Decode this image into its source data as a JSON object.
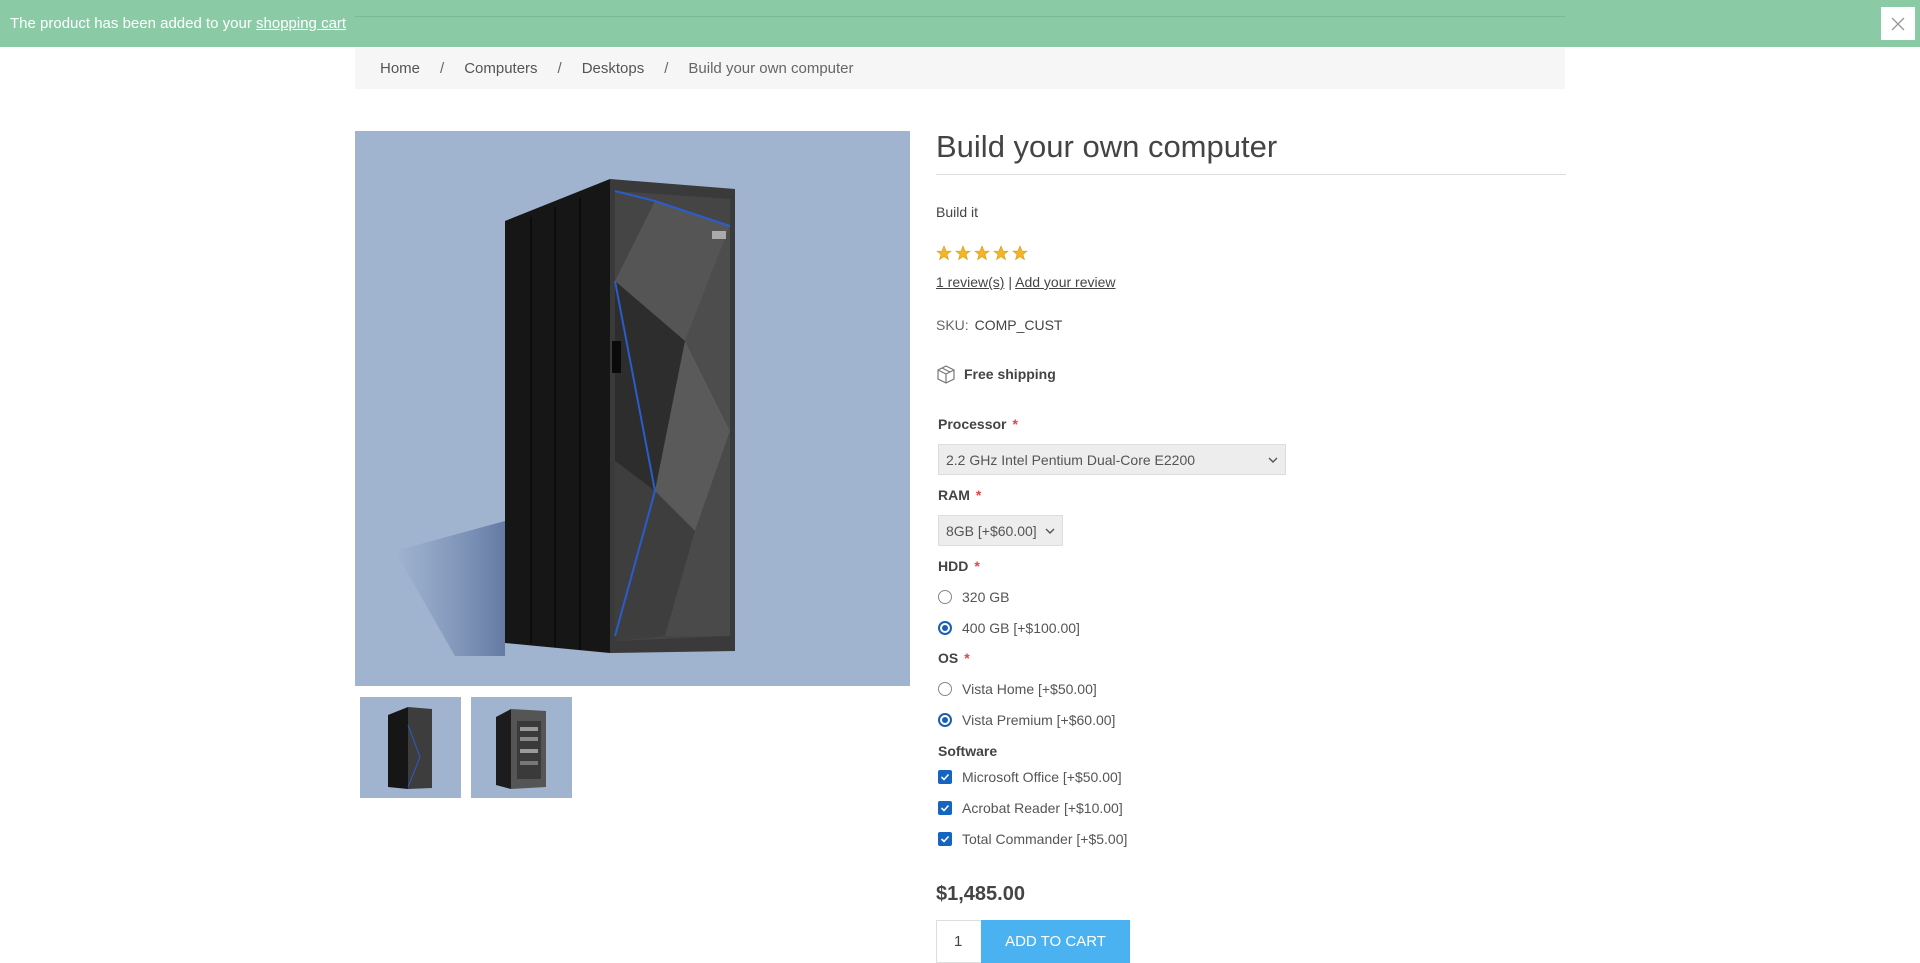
{
  "notification": {
    "message": "The product has been added to your ",
    "link_text": "shopping cart",
    "close_icon": "close-icon"
  },
  "breadcrumb": {
    "items": [
      "Home",
      "Computers",
      "Desktops",
      "Build your own computer"
    ],
    "separator": "/"
  },
  "product": {
    "title": "Build your own computer",
    "short_description": "Build it",
    "rating_stars": 5,
    "reviews_link": "1 review(s)",
    "review_divider": "|",
    "add_review_link": "Add your review",
    "sku_label": "SKU:",
    "sku_value": "COMP_CUST",
    "shipping": "Free shipping",
    "price": "$1,485.00",
    "quantity": "1",
    "add_to_cart": "ADD TO CART"
  },
  "attributes": {
    "processor": {
      "label": "Processor",
      "required": "*",
      "selected": "2.2 GHz Intel Pentium Dual-Core E2200"
    },
    "ram": {
      "label": "RAM",
      "required": "*",
      "selected": "8GB [+$60.00]"
    },
    "hdd": {
      "label": "HDD",
      "required": "*",
      "options": [
        "320 GB",
        "400 GB [+$100.00]"
      ],
      "selected_index": 1
    },
    "os": {
      "label": "OS",
      "required": "*",
      "options": [
        "Vista Home [+$50.00]",
        "Vista Premium [+$60.00]"
      ],
      "selected_index": 1
    },
    "software": {
      "label": "Software",
      "options": [
        "Microsoft Office [+$50.00]",
        "Acrobat Reader [+$10.00]",
        "Total Commander [+$5.00]"
      ],
      "checked": [
        true,
        true,
        true
      ]
    }
  },
  "colors": {
    "notification_bg": "#8acba6",
    "accent_button": "#4ab2f1",
    "required_star": "#e4434b",
    "image_bg": "#a0b3cf",
    "star_fill": "#f5b325"
  }
}
